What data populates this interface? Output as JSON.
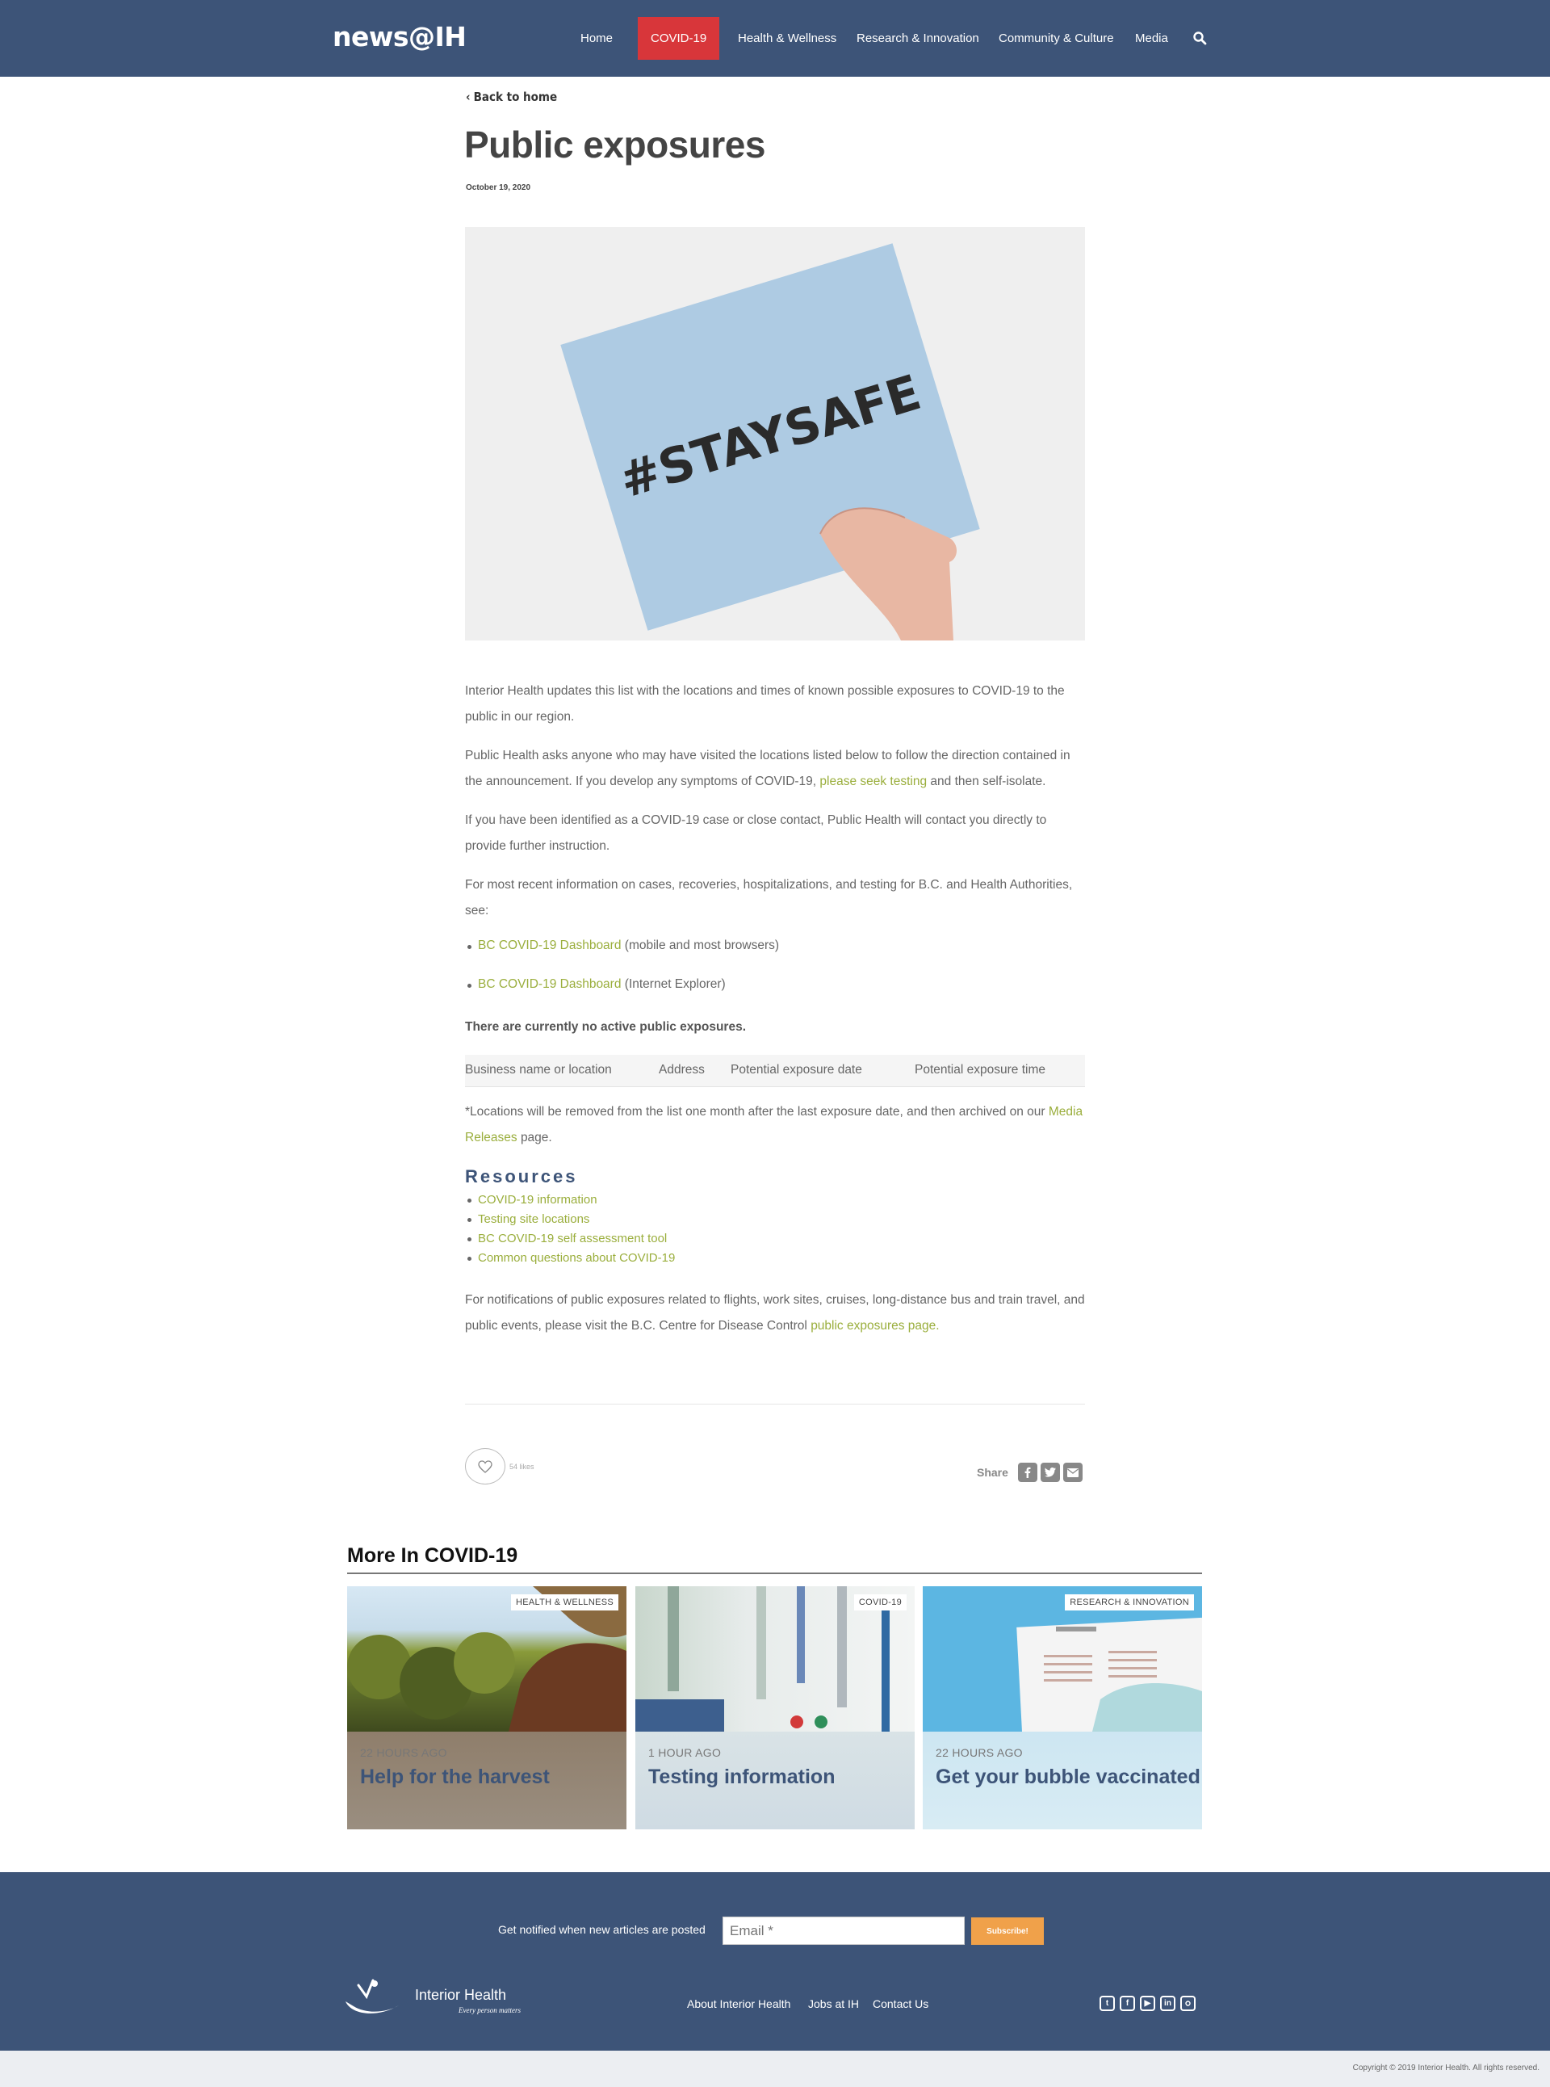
{
  "header": {
    "logo": "news@IH",
    "nav": [
      "Home",
      "COVID-19",
      "Health & Wellness",
      "Research & Innovation",
      "Community & Culture",
      "Media"
    ],
    "active_nav": "COVID-19",
    "accent_color": "#d8363a",
    "bar_color": "#3d5478"
  },
  "article": {
    "back_link": "Back to home",
    "title": "Public exposures",
    "date": "October 19, 2020",
    "hero_sign_text": "#STAYSAFE",
    "p1": "Interior Health updates this list with the locations and times of known possible exposures to COVID-19 to the public in our region.",
    "p2_before": "Public Health asks anyone who may have visited the locations listed below to follow the direction contained in the announcement. If you develop any symptoms of COVID-19,",
    "p2_link": "please seek testing",
    "p2_after": "and then self-isolate.",
    "p3": "If you have been identified as a COVID-19 case or close contact, Public Health will contact you directly to provide further instruction.",
    "p4": "For most recent information on cases, recoveries, hospitalizations, and testing for B.C. and Health Authorities, see:",
    "bullets": [
      {
        "link": "BC COVID-19 Dashboard",
        "text": "(mobile and most browsers)"
      },
      {
        "link": "BC COVID-19 Dashboard",
        "text": "(Internet Explorer)"
      }
    ],
    "no_exposures": "There are currently no active public exposures.",
    "table_headers": [
      "Business name or location",
      "Address",
      "Potential exposure date",
      "Potential exposure time"
    ],
    "note_before": "*Locations will be removed from the list one month after the last exposure date, and then archived on our",
    "note_link": "Media Releases",
    "note_after": "page.",
    "resources_title": "Resources",
    "resources": [
      "COVID-19 information",
      "Testing site locations",
      "BC COVID-19 self assessment tool",
      "Common questions about COVID-19"
    ],
    "final_before": "For notifications of public exposures related to flights, work sites, cruises, long-distance bus and train travel, and public events, please visit the B.C. Centre for Disease Control",
    "final_link": "public exposures page",
    "final_after": ".",
    "likes": "54 likes",
    "share_label": "Share",
    "link_color": "#9aae3c"
  },
  "more": {
    "title": "More In COVID-19",
    "cards": [
      {
        "tag": "HEALTH & WELLNESS",
        "time": "22 HOURS AGO",
        "title": "Help for the harvest"
      },
      {
        "tag": "COVID-19",
        "time": "1 HOUR AGO",
        "title": "Testing information"
      },
      {
        "tag": "RESEARCH & INNOVATION",
        "time": "22 HOURS AGO",
        "title": "Get your bubble vaccinated"
      }
    ]
  },
  "footer": {
    "notify_label": "Get notified when new articles are posted",
    "email_placeholder": "Email *",
    "subscribe_label": "Subscribe!",
    "logo_text": "Interior Health",
    "logo_tagline": "Every person matters",
    "links": [
      "About Interior Health",
      "Jobs at IH",
      "Contact Us"
    ],
    "social_icons": [
      "twitter-icon",
      "facebook-icon",
      "youtube-icon",
      "linkedin-icon",
      "instagram-icon"
    ],
    "copyright": "Copyright © 2019 Interior Health. All rights reserved.",
    "subscribe_color": "#f0a14a"
  }
}
